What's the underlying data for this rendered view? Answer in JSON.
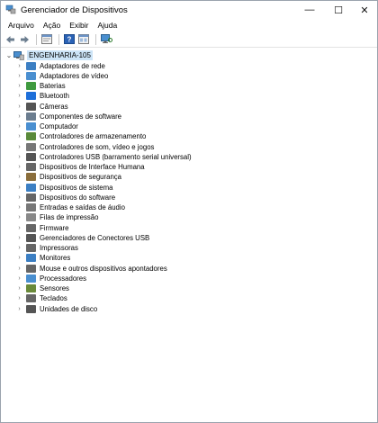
{
  "window": {
    "title": "Gerenciador de Dispositivos",
    "controls": {
      "minimize": "—",
      "maximize": "☐",
      "close": "✕"
    }
  },
  "menu": [
    {
      "label": "Arquivo"
    },
    {
      "label": "Ação"
    },
    {
      "label": "Exibir"
    },
    {
      "label": "Ajuda"
    }
  ],
  "toolbar": [
    {
      "name": "back-arrow-icon"
    },
    {
      "name": "forward-arrow-icon"
    },
    {
      "name": "separator"
    },
    {
      "name": "properties-icon"
    },
    {
      "name": "separator"
    },
    {
      "name": "help-icon"
    },
    {
      "name": "show-hidden-icon"
    },
    {
      "name": "separator"
    },
    {
      "name": "monitor-scan-icon"
    }
  ],
  "tree": {
    "root": {
      "label": "ENGENHARIA-105",
      "expander": "⌄"
    },
    "children": [
      {
        "label": "Adaptadores de rede",
        "icon": "network-icon",
        "color": "#3c7fc3"
      },
      {
        "label": "Adaptadores de vídeo",
        "icon": "display-adapter-icon",
        "color": "#4a8fd0"
      },
      {
        "label": "Baterias",
        "icon": "battery-icon",
        "color": "#3f9a3f"
      },
      {
        "label": "Bluetooth",
        "icon": "bluetooth-icon",
        "color": "#1e6fd9"
      },
      {
        "label": "Câmeras",
        "icon": "camera-icon",
        "color": "#555555"
      },
      {
        "label": "Componentes de software",
        "icon": "software-component-icon",
        "color": "#6b7d8f"
      },
      {
        "label": "Computador",
        "icon": "computer-icon",
        "color": "#4a8fd0"
      },
      {
        "label": "Controladores de armazenamento",
        "icon": "storage-controller-icon",
        "color": "#5a8a3a"
      },
      {
        "label": "Controladores de som, vídeo e jogos",
        "icon": "speaker-icon",
        "color": "#777777"
      },
      {
        "label": "Controladores USB (barramento serial universal)",
        "icon": "usb-icon",
        "color": "#555555"
      },
      {
        "label": "Dispositivos de Interface Humana",
        "icon": "hid-icon",
        "color": "#666666"
      },
      {
        "label": "Dispositivos de segurança",
        "icon": "security-icon",
        "color": "#8a6d3b"
      },
      {
        "label": "Dispositivos de sistema",
        "icon": "system-device-icon",
        "color": "#3c7fc3"
      },
      {
        "label": "Dispositivos do software",
        "icon": "software-device-icon",
        "color": "#666666"
      },
      {
        "label": "Entradas e saídas de áudio",
        "icon": "audio-io-icon",
        "color": "#777777"
      },
      {
        "label": "Filas de impressão",
        "icon": "print-queue-icon",
        "color": "#888888"
      },
      {
        "label": "Firmware",
        "icon": "firmware-icon",
        "color": "#666666"
      },
      {
        "label": "Gerenciadores de Conectores USB",
        "icon": "usb-connector-icon",
        "color": "#555555"
      },
      {
        "label": "Impressoras",
        "icon": "printer-icon",
        "color": "#666666"
      },
      {
        "label": "Monitores",
        "icon": "monitor-icon",
        "color": "#3c7fc3"
      },
      {
        "label": "Mouse e outros dispositivos apontadores",
        "icon": "mouse-icon",
        "color": "#666666"
      },
      {
        "label": "Processadores",
        "icon": "processor-icon",
        "color": "#4a8fd0"
      },
      {
        "label": "Sensores",
        "icon": "sensor-icon",
        "color": "#6a8a3a"
      },
      {
        "label": "Teclados",
        "icon": "keyboard-icon",
        "color": "#666666"
      },
      {
        "label": "Unidades de disco",
        "icon": "disk-drive-icon",
        "color": "#555555"
      }
    ]
  }
}
